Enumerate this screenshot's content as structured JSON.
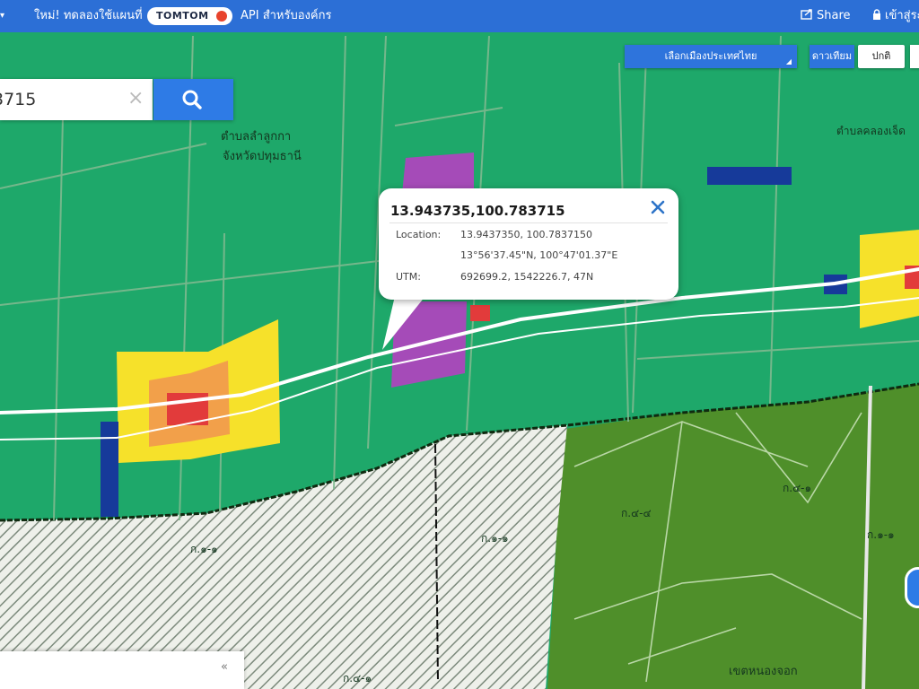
{
  "topbar": {
    "nav_caret": "▾",
    "promo_text": "ใหม่! ทดลองใช้แผนที่",
    "brand_label": "TOMTOM",
    "api_link": "API สำหรับองค์กร",
    "share_label": "Share",
    "login_label": "เข้าสู่ระบบ",
    "bg_color": "#2c6fd6"
  },
  "map_controls": {
    "province_select": "เลือกเมืองประเทศไทย",
    "satellite": "ดาวเทียม",
    "standard": "ปกติ"
  },
  "search": {
    "value": "3715",
    "clear_icon": "×",
    "button_icon": "search-icon"
  },
  "popup": {
    "title": "13.943735,100.783715",
    "location_label": "Location:",
    "location_decimal": "13.9437350, 100.7837150",
    "location_dms": "13°56'37.45\"N, 100°47'01.37\"E",
    "utm_label": "UTM:",
    "utm_value": "692699.2, 1542226.7, 47N",
    "close_icon": "close-icon"
  },
  "map_labels": {
    "district_line1": "ตำบลลำลูกกา",
    "district_line2": "จังหวัดปทุมธานี",
    "subdistrict_right": "ตำบลคลองเจ็ด",
    "zone_a": "ก.๑-๑",
    "zone_b": "ก.๑-๑",
    "zone_c": "ก.๔-๔",
    "zone_d": "ก.๔-๑",
    "zone_e": "ก.๑-๑",
    "zone_f": "ก.๔-๑",
    "bottom_area": "เขตหนองจอก"
  },
  "bottom_panel": {
    "expand_icon": "«"
  },
  "colors": {
    "zone_green": "#1ea86a",
    "rural_green": "#4f8f2a",
    "community_yellow": "#f6e12a",
    "commercial_orange": "#f2a04a",
    "residential_red": "#e23b3b",
    "institution_purple": "#a54bb8",
    "water_blue": "#163a9a",
    "accent_blue": "#2e7be6"
  }
}
